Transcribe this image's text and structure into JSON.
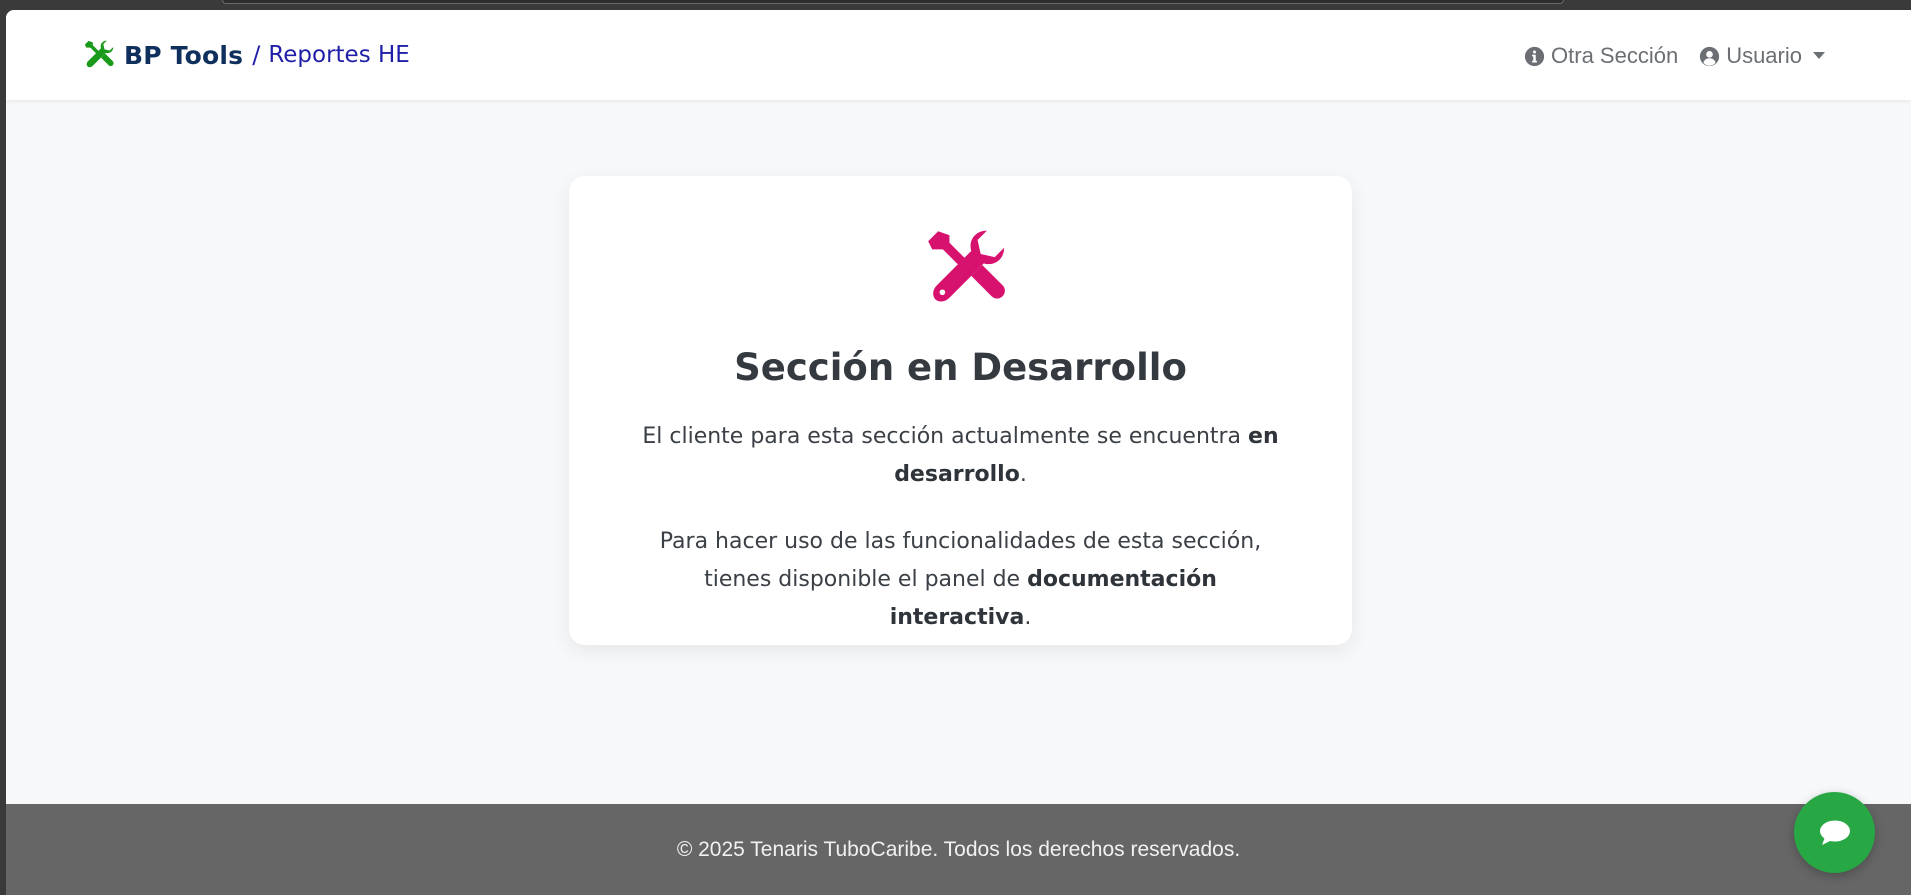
{
  "navbar": {
    "brand_name": "BP Tools",
    "brand_separator": "/",
    "brand_subtitle": "Reportes HE",
    "brand_icon": "tools-icon",
    "links": [
      {
        "label": "Otra Sección",
        "icon": "info-circle-icon"
      },
      {
        "label": "Usuario",
        "icon": "user-circle-icon",
        "dropdown": true
      }
    ]
  },
  "card": {
    "icon": "tools-icon",
    "title": "Sección en Desarrollo",
    "paragraph1": {
      "text": "El cliente para esta sección actualmente se encuentra ",
      "bold": "en desarrollo",
      "end": "."
    },
    "paragraph2": {
      "text": "Para hacer uso de las funcionalidades de esta sección, tienes disponible el panel de ",
      "bold": "documentación interactiva",
      "end": "."
    }
  },
  "footer": {
    "text": "© 2025 Tenaris TuboCaribe. Todos los derechos reservados."
  },
  "chat": {
    "icon": "chat-bubble-icon"
  },
  "colors": {
    "brand_icon": "#1a9a1a",
    "brand_name": "#0f2f5c",
    "brand_subtitle": "#1f1fa8",
    "accent_icon": "#d6116e",
    "footer_bg": "#666666",
    "chat_button": "#28a745",
    "page_bg": "#f7f8fa"
  }
}
